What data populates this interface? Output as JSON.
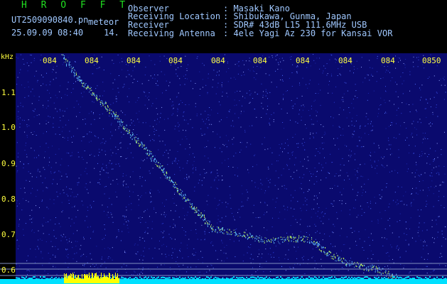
{
  "header": {
    "app_title": "H R O F F T",
    "file_name": "UT2509090840.pn",
    "mode": "meteor",
    "date_time": "25.09.09 08:40",
    "channel": "14.",
    "fields": [
      {
        "label": "Observer",
        "value": ": Masaki Kano"
      },
      {
        "label": "Receiving Location",
        "value": ": Shibukawa, Gunma, Japan"
      },
      {
        "label": "Receiver",
        "value": ": SDR# 43dB L15 111.6MHz USB"
      },
      {
        "label": "Receiving Antenna",
        "value": ": 4ele Yagi Az 230 for Kansai VOR"
      }
    ]
  },
  "spectrogram": {
    "unit_label": "kHz",
    "time_ticks": [
      "084",
      "084",
      "084",
      "084",
      "084",
      "084",
      "084",
      "084",
      "084",
      "0850"
    ],
    "freq_ticks": [
      "1.1",
      "1.0",
      "0.9",
      "0.8",
      "0.7",
      "0.6"
    ],
    "colors": {
      "background": "#0a0a6e",
      "signal": "#c0ff60",
      "labels": "#ffff40",
      "baseline": "#00e0ff",
      "noise_burst": "#ffff00"
    }
  }
}
